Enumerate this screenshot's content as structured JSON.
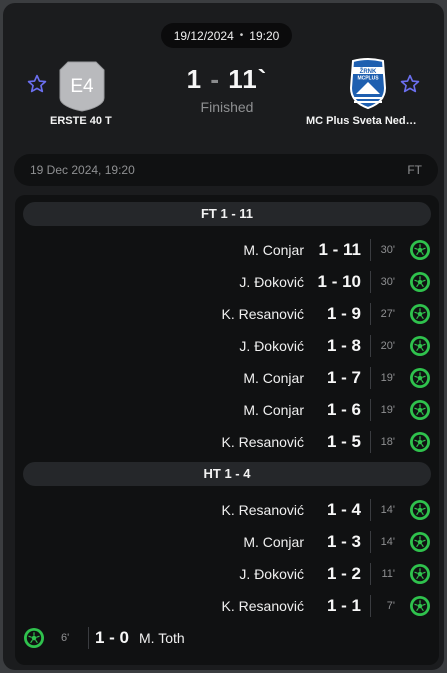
{
  "header": {
    "date": "19/12/2024",
    "time": "19:20",
    "home": {
      "name": "ERSTE 40 T",
      "crest_text": "E4"
    },
    "away": {
      "name": "MC Plus Sveta Ned…",
      "crest_top": "ŽRNK",
      "crest_band": "MCPLUS"
    },
    "score": {
      "home": "1",
      "dash": " - ",
      "away": "11",
      "mark": "`"
    },
    "status": "Finished"
  },
  "info": {
    "datetime": "19 Dec 2024, 19:20",
    "period": "FT"
  },
  "sections": [
    {
      "label": "FT 1 - 11",
      "events": [
        {
          "side": "home",
          "player": "M. Conjar",
          "score": "1 - 11",
          "minute": "30'"
        },
        {
          "side": "home",
          "player": "J. Đoković",
          "score": "1 - 10",
          "minute": "30'"
        },
        {
          "side": "home",
          "player": "K. Resanović",
          "score": "1 - 9",
          "minute": "27'"
        },
        {
          "side": "home",
          "player": "J. Đoković",
          "score": "1 - 8",
          "minute": "20'"
        },
        {
          "side": "home",
          "player": "M. Conjar",
          "score": "1 - 7",
          "minute": "19'"
        },
        {
          "side": "home",
          "player": "M. Conjar",
          "score": "1 - 6",
          "minute": "19'"
        },
        {
          "side": "home",
          "player": "K. Resanović",
          "score": "1 - 5",
          "minute": "18'"
        }
      ]
    },
    {
      "label": "HT 1 - 4",
      "events": [
        {
          "side": "home",
          "player": "K. Resanović",
          "score": "1 - 4",
          "minute": "14'"
        },
        {
          "side": "home",
          "player": "M. Conjar",
          "score": "1 - 3",
          "minute": "14'"
        },
        {
          "side": "home",
          "player": "J. Đoković",
          "score": "1 - 2",
          "minute": "11'"
        },
        {
          "side": "home",
          "player": "K. Resanović",
          "score": "1 - 1",
          "minute": "7'"
        },
        {
          "side": "away",
          "player": "M. Toth",
          "score": "1 - 0",
          "minute": "6'"
        }
      ]
    }
  ],
  "colors": {
    "accent_star": "#6b6ff0",
    "goal_green": "#2fc24d",
    "home_crest": "#b9babd",
    "away_crest": "#1e5fb0"
  },
  "icons": {
    "favorite": "star-outline-icon",
    "goal": "soccer-ball-icon"
  }
}
